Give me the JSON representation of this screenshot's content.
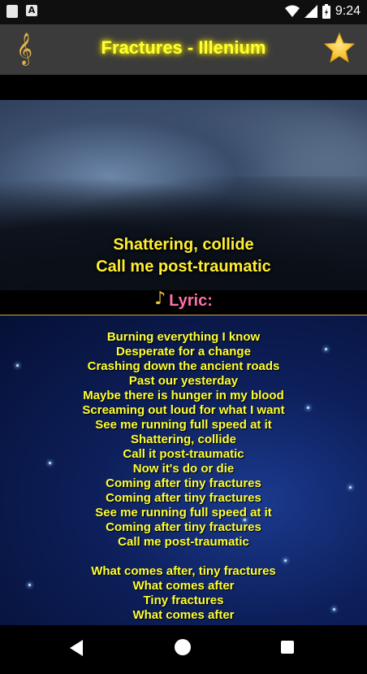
{
  "status_bar": {
    "time": "9:24",
    "icons": [
      "sd-card-icon",
      "a-icon",
      "wifi-icon",
      "signal-icon",
      "battery-charging-icon"
    ],
    "a_glyph": "A"
  },
  "app_bar": {
    "title": "Fractures - Illenium",
    "left_icon": "treble-clef-icon",
    "right_icon": "star-favorite-icon",
    "title_color": "#ffff33",
    "background": "#3b3b3b"
  },
  "video": {
    "subtitles": [
      "Shattering, collide",
      "Call me post-traumatic"
    ]
  },
  "lyric_section": {
    "label": "Lyric:",
    "label_color": "#ff6fa8"
  },
  "lyrics": [
    "Burning everything I know",
    "Desperate for a change",
    "Crashing down the ancient roads",
    "Past our yesterday",
    "Maybe there is hunger in my blood",
    "Screaming out loud for what I want",
    "See me running full speed at it",
    "Shattering, collide",
    "Call it post-traumatic",
    "Now it's do or die",
    "Coming after tiny fractures",
    "Coming after tiny fractures",
    "See me running full speed at it",
    "Coming after tiny fractures",
    "Call me post-traumatic",
    "",
    "What comes after, tiny fractures",
    "What comes after",
    "Tiny fractures",
    "What comes after"
  ],
  "nav_bar": {
    "icons": [
      "back-icon",
      "home-icon",
      "recent-apps-icon"
    ]
  }
}
